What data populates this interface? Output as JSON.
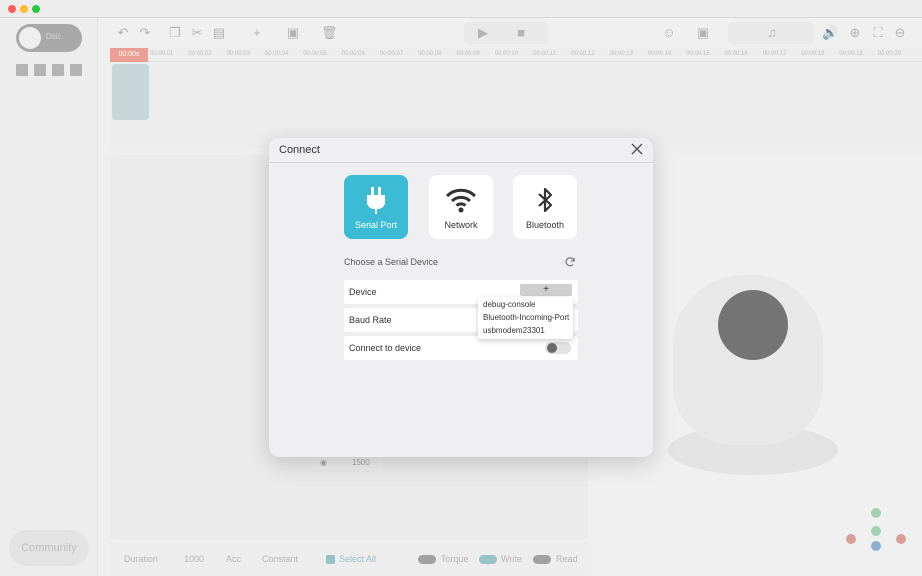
{
  "window": {
    "colors": {
      "close": "#ff5f57",
      "minimize": "#febc2e",
      "zoom": "#28c840"
    }
  },
  "sidebar": {
    "community_label": "Community",
    "toggle_label": "Dsic"
  },
  "timeline": {
    "playhead": "00:00s",
    "ticks": [
      "00:00:01",
      "00:00:02",
      "00:00:03",
      "00:00:04",
      "00:00:05",
      "00:00:06",
      "00:00:07",
      "00:00:08",
      "00:00:09",
      "00:00:10",
      "00:00:11",
      "00:00:12",
      "00:00:13",
      "00:00:14",
      "00:00:15",
      "00:00:16",
      "00:00:17",
      "00:00:18",
      "00:00:19",
      "00:00:20"
    ]
  },
  "bottombar": {
    "duration_label": "Duration",
    "duration_value": "1000",
    "acc_label": "Acc",
    "constant_label": "Constant",
    "select_all_label": "Select All",
    "torque_label": "Torque",
    "write_label": "Write",
    "read_label": "Read"
  },
  "stepper": {
    "value": "1500"
  },
  "modal": {
    "title": "Connect",
    "tabs": [
      {
        "label": "Serial Port",
        "icon": "usb-plug-icon",
        "active": true
      },
      {
        "label": "Network",
        "icon": "wifi-icon",
        "active": false
      },
      {
        "label": "Bluetooth",
        "icon": "bluetooth-icon",
        "active": false
      }
    ],
    "choose_label": "Choose a Serial Device",
    "device_label": "Device",
    "device_button": "+",
    "baud_label": "Baud Rate",
    "connect_label": "Connect to device",
    "device_options": [
      "debug-console",
      "Bluetooth-Incoming-Port",
      "usbmodem23301"
    ],
    "accent": "#3bbbd4"
  }
}
